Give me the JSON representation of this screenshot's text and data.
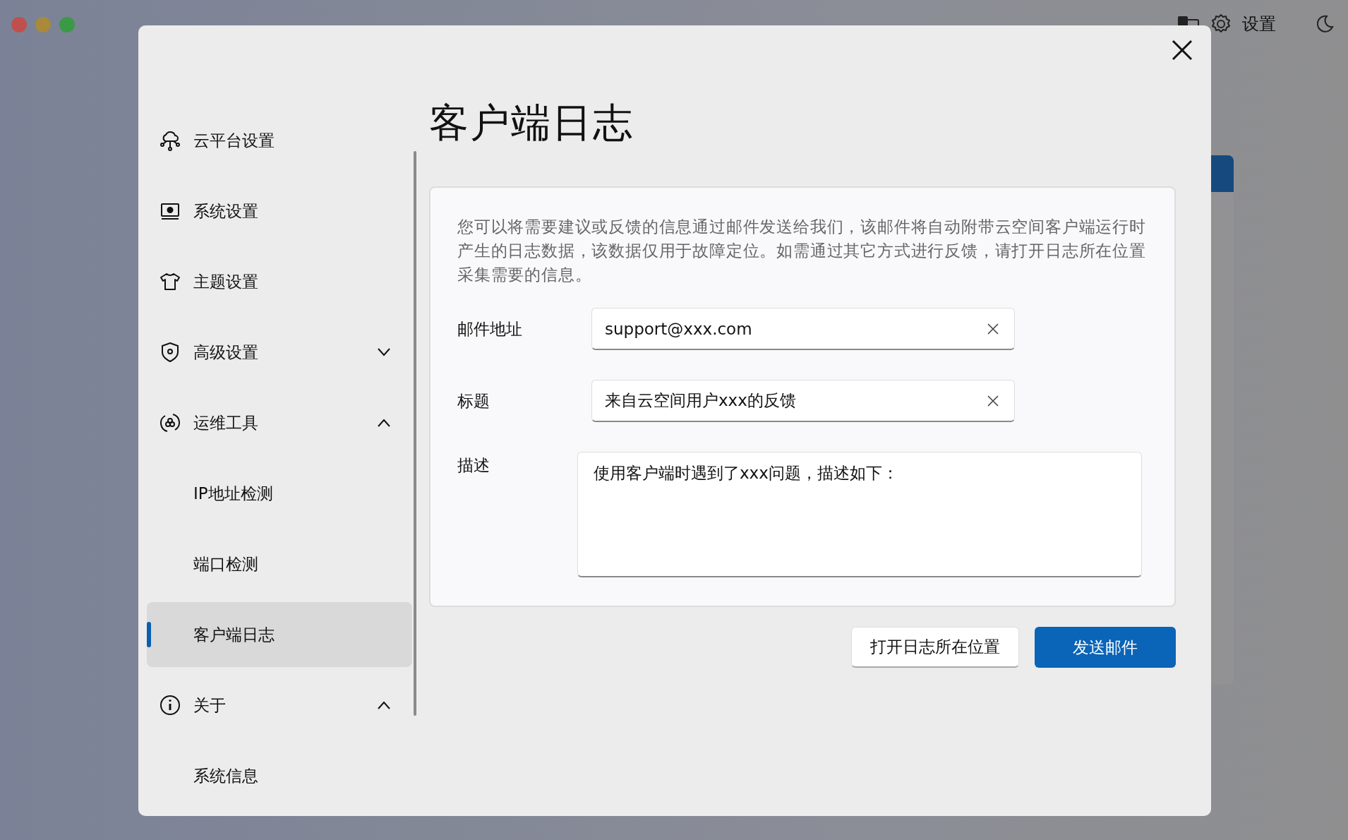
{
  "topbar": {
    "settings_label": "设置"
  },
  "dialog": {
    "title": "客户端日志",
    "sidebar": {
      "items": [
        {
          "label": "云平台设置",
          "selected": false
        },
        {
          "label": "系统设置",
          "selected": false
        },
        {
          "label": "主题设置",
          "selected": false
        },
        {
          "label": "高级设置",
          "selected": false,
          "expanded": false
        },
        {
          "label": "运维工具",
          "selected": false,
          "expanded": true,
          "children": [
            {
              "label": "IP地址检测",
              "selected": false
            },
            {
              "label": "端口检测",
              "selected": false
            },
            {
              "label": "客户端日志",
              "selected": true
            }
          ]
        },
        {
          "label": "关于",
          "selected": false,
          "expanded": true,
          "children": [
            {
              "label": "系统信息",
              "selected": false
            }
          ]
        }
      ]
    },
    "card": {
      "description": "您可以将需要建议或反馈的信息通过邮件发送给我们，该邮件将自动附带云空间客户端运行时产生的日志数据，该数据仅用于故障定位。如需通过其它方式进行反馈，请打开日志所在位置采集需要的信息。",
      "fields": [
        {
          "kind": "input",
          "label": "邮件地址",
          "value": "support@xxx.com"
        },
        {
          "kind": "input",
          "label": "标题",
          "value": "来自云空间用户xxx的反馈"
        },
        {
          "kind": "textarea",
          "label": "描述",
          "value": "使用客户端时遇到了xxx问题，描述如下："
        }
      ]
    },
    "buttons": [
      {
        "label": "打开日志所在位置",
        "kind": "secondary"
      },
      {
        "label": "发送邮件",
        "kind": "primary"
      }
    ]
  }
}
